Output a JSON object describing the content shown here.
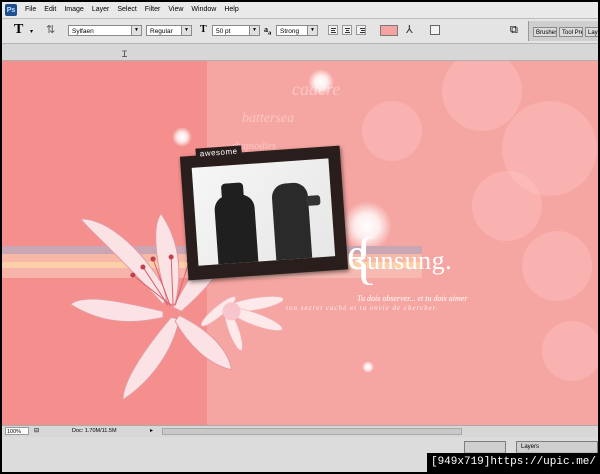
{
  "menu": [
    "File",
    "Edit",
    "Image",
    "Layer",
    "Select",
    "Filter",
    "View",
    "Window",
    "Help"
  ],
  "options": {
    "font_family": "Sylfaen",
    "font_style": "Regular",
    "font_size": "50 pt",
    "antialias_label": "a",
    "antialias_sub": "a",
    "antialias": "Strong",
    "text_color": "#f5a3a0"
  },
  "panel_wells": [
    "Brushes",
    "Tool Pre",
    "Layer"
  ],
  "artwork": {
    "tag": "awesome",
    "headline_initial": "e",
    "headline_rest": "unsung.",
    "line1": "Tu dois observer... et tu dois aimer",
    "line2": "ton secret caché et ta envie de chercher.",
    "bg_text_1": "cadere",
    "bg_text_2": "battersea",
    "bg_text_3": "rhapsodies"
  },
  "status": {
    "zoom": "100%",
    "doc": "Doc: 1.70M/11.5M"
  },
  "bottom_panels": [
    "Layers"
  ],
  "watermark": "[949x719]https://upic.me/"
}
